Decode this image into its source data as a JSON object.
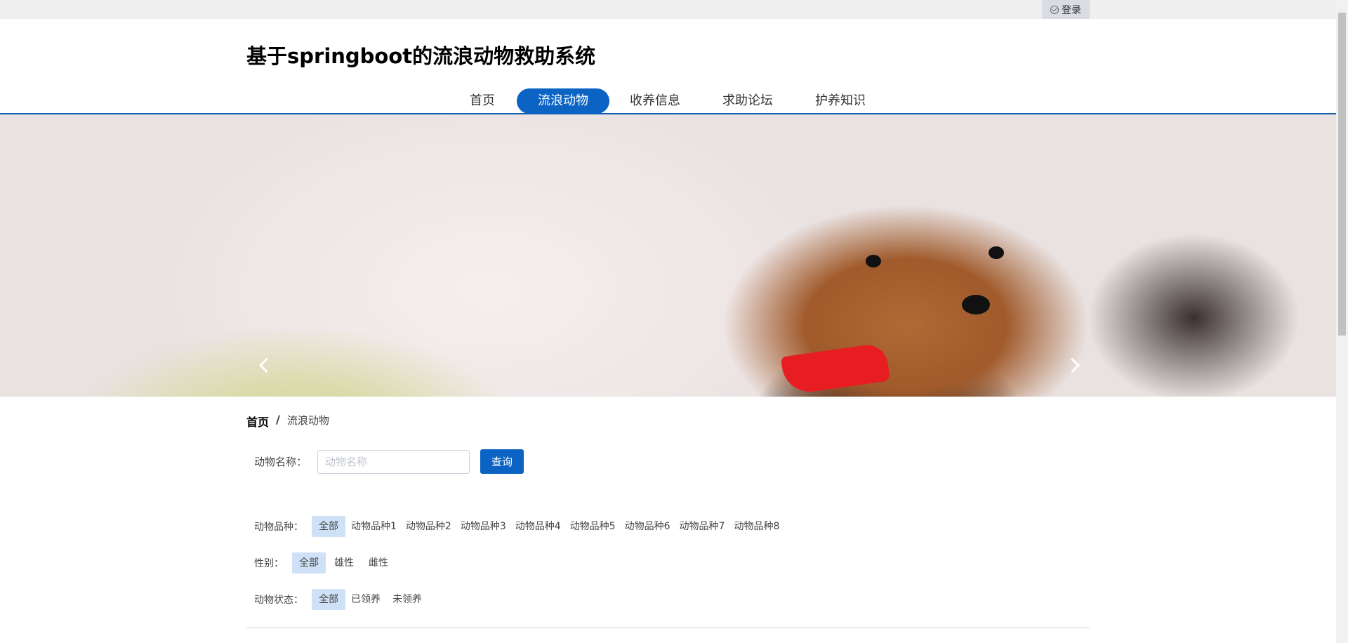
{
  "topbar": {
    "login_label": "登录"
  },
  "site": {
    "title": "基于springboot的流浪动物救助系统"
  },
  "nav": {
    "items": [
      {
        "label": "首页"
      },
      {
        "label": "流浪动物",
        "active": true
      },
      {
        "label": "收养信息"
      },
      {
        "label": "求助论坛"
      },
      {
        "label": "护养知识"
      }
    ]
  },
  "banner": {
    "slide_count": 3,
    "active_slide": 2
  },
  "breadcrumb": {
    "home": "首页",
    "separator": "/",
    "current": "流浪动物"
  },
  "search": {
    "label": "动物名称：",
    "placeholder": "动物名称",
    "value": "",
    "button": "查询"
  },
  "filters": {
    "breed": {
      "label": "动物品种：",
      "options": [
        "全部",
        "动物品种1",
        "动物品种2",
        "动物品种3",
        "动物品种4",
        "动物品种5",
        "动物品种6",
        "动物品种7",
        "动物品种8"
      ],
      "selected": "全部"
    },
    "gender": {
      "label": "性别：",
      "options": [
        "全部",
        "雄性",
        "雌性"
      ],
      "selected": "全部"
    },
    "status": {
      "label": "动物状态：",
      "options": [
        "全部",
        "已领养",
        "未领养"
      ],
      "selected": "全部"
    }
  },
  "colors": {
    "primary": "#0b63c3",
    "chip_selected": "#cfe1f6",
    "nav_border": "#0d5cad"
  },
  "icons": {
    "login": "check-circle-icon",
    "prev": "chevron-left-icon",
    "next": "chevron-right-icon"
  }
}
